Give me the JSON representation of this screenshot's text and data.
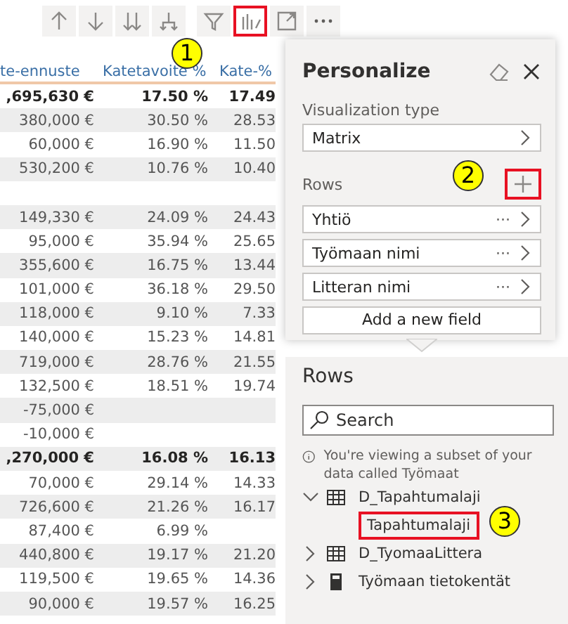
{
  "toolbar": {
    "buttons": [
      {
        "kind": "up"
      },
      {
        "kind": "down"
      },
      {
        "kind": "double-down"
      },
      {
        "kind": "expand"
      },
      {
        "kind": "filter"
      },
      {
        "kind": "personalize",
        "highlighted": true
      },
      {
        "kind": "focus"
      },
      {
        "kind": "more"
      }
    ]
  },
  "table": {
    "columns": [
      "te-ennuste",
      "Katetavoite %",
      "Kate-%"
    ],
    "rows": [
      {
        "bold": true,
        "cells": [
          ",695,630 €",
          "17.50 %",
          "17.49"
        ]
      },
      {
        "bold": false,
        "cells": [
          "380,000 €",
          "30.50 %",
          "28.53"
        ]
      },
      {
        "bold": false,
        "cells": [
          "60,000 €",
          "16.90 %",
          "11.50"
        ]
      },
      {
        "bold": false,
        "cells": [
          "530,200 €",
          "10.76 %",
          "10.40"
        ]
      },
      {
        "cells": []
      },
      {
        "bold": false,
        "cells": [
          "149,330 €",
          "24.09 %",
          "24.43"
        ]
      },
      {
        "bold": false,
        "cells": [
          "95,000 €",
          "35.94 %",
          "25.65"
        ]
      },
      {
        "bold": false,
        "cells": [
          "355,600 €",
          "16.75 %",
          "13.44"
        ]
      },
      {
        "bold": false,
        "cells": [
          "101,000 €",
          "36.18 %",
          "29.50"
        ]
      },
      {
        "bold": false,
        "cells": [
          "118,000 €",
          "9.10 %",
          "7.33"
        ]
      },
      {
        "bold": false,
        "cells": [
          "140,000 €",
          "15.23 %",
          "14.81"
        ]
      },
      {
        "bold": false,
        "cells": [
          "719,000 €",
          "28.76 %",
          "21.55"
        ]
      },
      {
        "bold": false,
        "cells": [
          "132,500 €",
          "18.51 %",
          "19.74"
        ]
      },
      {
        "bold": false,
        "cells": [
          "-75,000 €"
        ]
      },
      {
        "bold": false,
        "cells": [
          "-10,000 €"
        ]
      },
      {
        "bold": true,
        "cells": [
          ",270,000 €",
          "16.08 %",
          "16.13"
        ]
      },
      {
        "bold": false,
        "cells": [
          "70,000 €",
          "29.14 %",
          "14.33"
        ]
      },
      {
        "bold": false,
        "cells": [
          "726,600 €",
          "21.26 %",
          "16.17"
        ]
      },
      {
        "bold": false,
        "cells": [
          "87,400 €",
          "6.99 %"
        ]
      },
      {
        "bold": false,
        "cells": [
          "440,800 €",
          "19.17 %",
          "21.20"
        ]
      },
      {
        "bold": false,
        "cells": [
          "119,500 €",
          "19.65 %",
          "14.36"
        ]
      },
      {
        "bold": false,
        "cells": [
          "90,000 €",
          "19.57 %",
          "16.25"
        ]
      }
    ]
  },
  "personalize": {
    "title": "Personalize",
    "visualization_label": "Visualization type",
    "visualization_value": "Matrix",
    "rows_label": "Rows",
    "add_highlighted": true,
    "fields": [
      "Yhtiö",
      "Työmaan nimi",
      "Litteran nimi"
    ],
    "more": "···",
    "add_button": "Add a new field"
  },
  "field_list": {
    "title": "Rows",
    "search_placeholder": "Search",
    "info": "You're viewing a subset of your data called Työmaat",
    "tree": [
      {
        "label": "D_Tapahtumalaji",
        "kind": "table",
        "expanded": true,
        "children": [
          {
            "label": "Tapahtumalaji",
            "highlighted": true
          }
        ]
      },
      {
        "label": "D_TyomaaLittera",
        "kind": "table",
        "expanded": false
      },
      {
        "label": "Työmaan tietokentät",
        "kind": "calculator",
        "expanded": false
      }
    ]
  },
  "badges": [
    "1",
    "2",
    "3"
  ]
}
